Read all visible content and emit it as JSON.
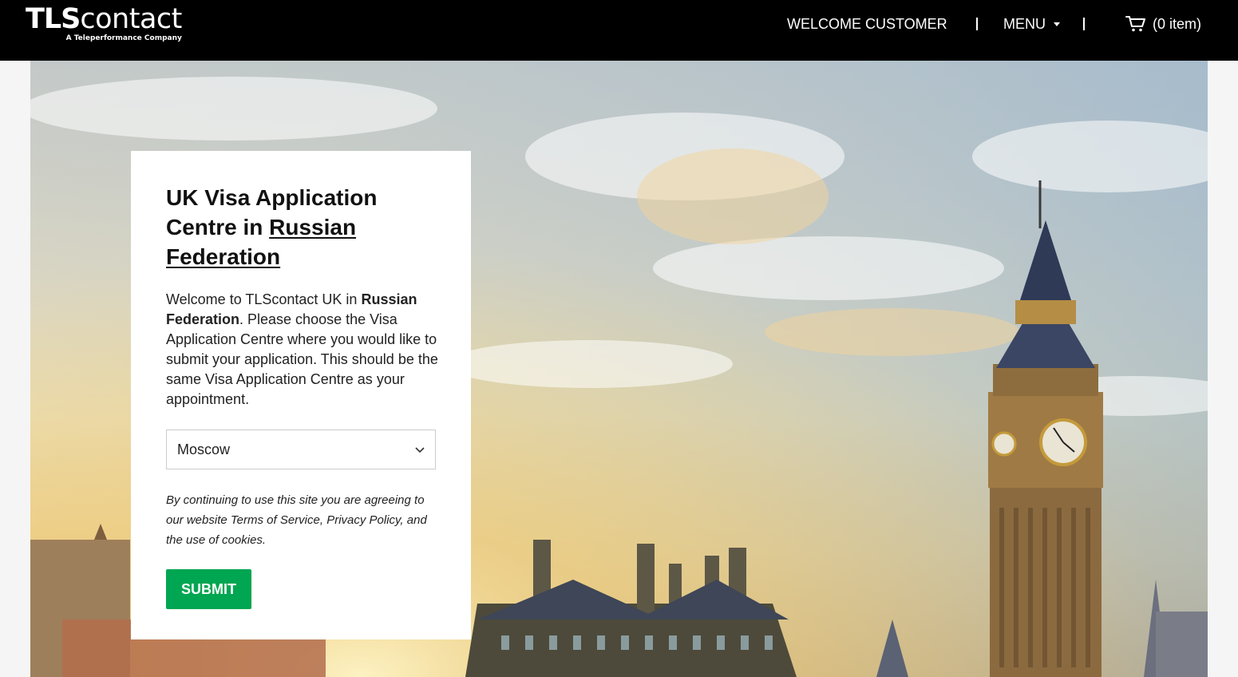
{
  "header": {
    "logo_main_bold": "TLS",
    "logo_main_rest": "contact",
    "logo_sub": "A Teleperformance Company",
    "welcome": "WELCOME CUSTOMER",
    "menu_label": "MENU",
    "cart_label": "(0 item)"
  },
  "card": {
    "title_line1": "UK Visa Application",
    "title_line2_prefix": "Centre in ",
    "title_link": "Russian Federation",
    "intro_pre": "Welcome to TLScontact UK in ",
    "intro_country": "Russian Federation",
    "intro_post": ". Please choose the Visa Application Centre where you would like to submit your application. This should be the same Visa Application Centre as your appointment.",
    "select_value": "Moscow",
    "legal": "By continuing to use this site you are agreeing to our website Terms of Service, Privacy Policy, and the use of cookies.",
    "submit_label": "SUBMIT"
  },
  "colors": {
    "header_bg": "#000000",
    "submit_bg": "#00a651",
    "page_bg": "#f5f5f5"
  },
  "icons": [
    "cart-icon",
    "caret-down-icon",
    "chevron-down-icon"
  ]
}
